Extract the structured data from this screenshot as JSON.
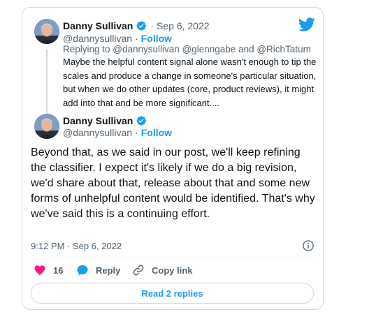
{
  "colors": {
    "accent": "#1d9bf0",
    "like": "#f91880",
    "muted": "#536471",
    "text": "#0f1419",
    "border": "#cfd9de"
  },
  "icons": {
    "brand": "twitter-bird-icon",
    "verified": "verified-badge-icon",
    "info": "info-icon",
    "like": "heart-icon",
    "reply": "reply-bubble-icon",
    "copy": "link-icon"
  },
  "parent_tweet": {
    "author_name": "Danny Sullivan",
    "date_sep": "·",
    "date": "Sep 6, 2022",
    "handle": "@dannysullivan",
    "follow_sep": "·",
    "follow_label": "Follow",
    "replying_to": "Replying to @dannysullivan @glenngabe and @RichTatum",
    "text": "Maybe the helpful content signal alone wasn't enough to tip the scales and produce a change in someone's particular situation, but when we do other updates (core, product reviews), it might add into that and be more significant...."
  },
  "main_tweet": {
    "author_name": "Danny Sullivan",
    "handle": "@dannysullivan",
    "follow_sep": "·",
    "follow_label": "Follow",
    "text": "Beyond that, as we said in our post, we'll keep refining the classifier. I expect it's likely if we do a big revision, we'd share about that, release about that and some new forms of unhelpful content would be identified. That's why we've said this is a continuing effort.",
    "timestamp": "9:12 PM · Sep 6, 2022"
  },
  "actions": {
    "like_count": "16",
    "reply_label": "Reply",
    "copy_label": "Copy link",
    "read_replies_label": "Read 2 replies"
  }
}
